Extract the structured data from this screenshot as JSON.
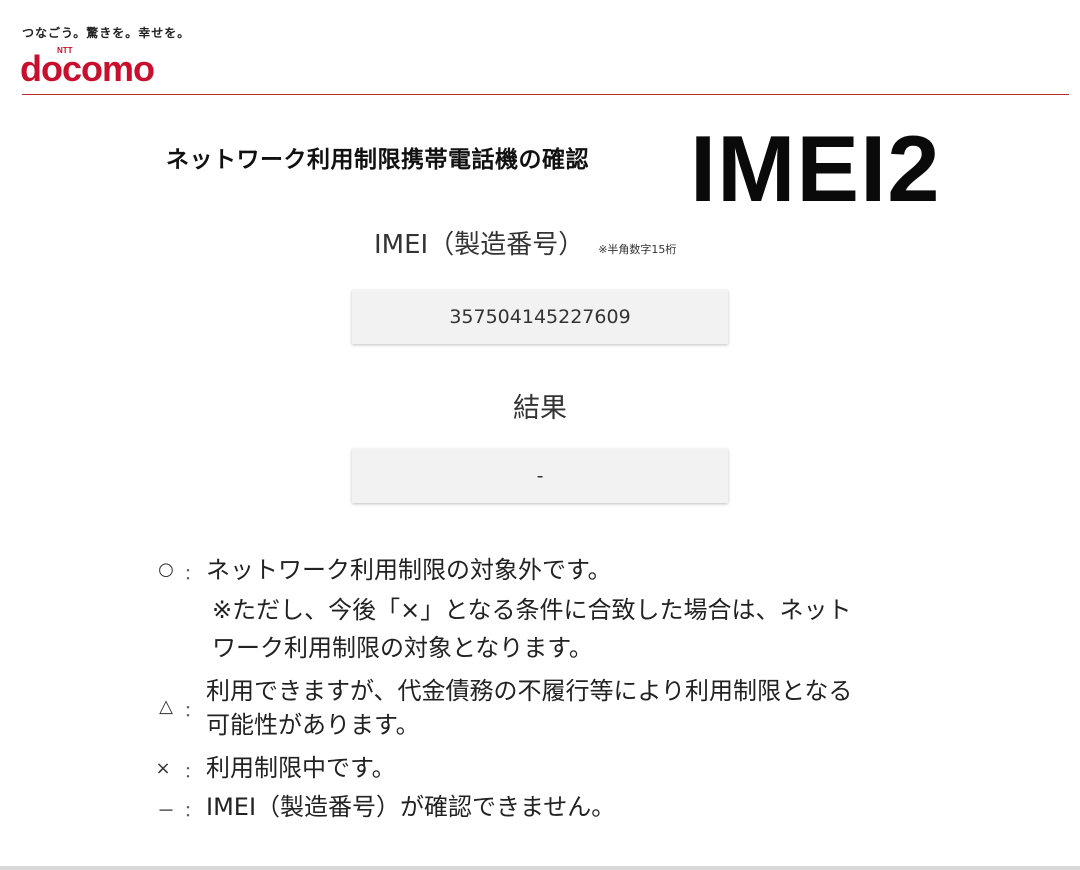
{
  "header": {
    "tagline": "つなごう。驚きを。幸せを。",
    "logo_ntt": "NTT",
    "logo_text": "docomo",
    "brand_color": "#c8102e"
  },
  "overlay_caption": "IMEI2",
  "main": {
    "title": "ネットワーク利用制限携帯電話機の確認",
    "imei_label": "IMEI（製造番号）",
    "imei_note": "※半角数字15桁",
    "imei_value": "357504145227609",
    "result_label": "結果",
    "result_value": "-"
  },
  "legend": {
    "circle": {
      "symbol": "○",
      "colon": "：",
      "text": "ネットワーク利用制限の対象外です。",
      "note_line1": "※ただし、今後「×」となる条件に合致した場合は、ネット",
      "note_line2": "ワーク利用制限の対象となります。"
    },
    "triangle": {
      "symbol": "△",
      "colon": "：",
      "line1": "利用できますが、代金債務の不履行等により利用制限となる",
      "line2": "可能性があります。"
    },
    "cross": {
      "symbol": "×",
      "colon": "：",
      "text": "利用制限中です。"
    },
    "dash": {
      "symbol": "－",
      "colon": "：",
      "text": "IMEI（製造番号）が確認できません。"
    }
  }
}
